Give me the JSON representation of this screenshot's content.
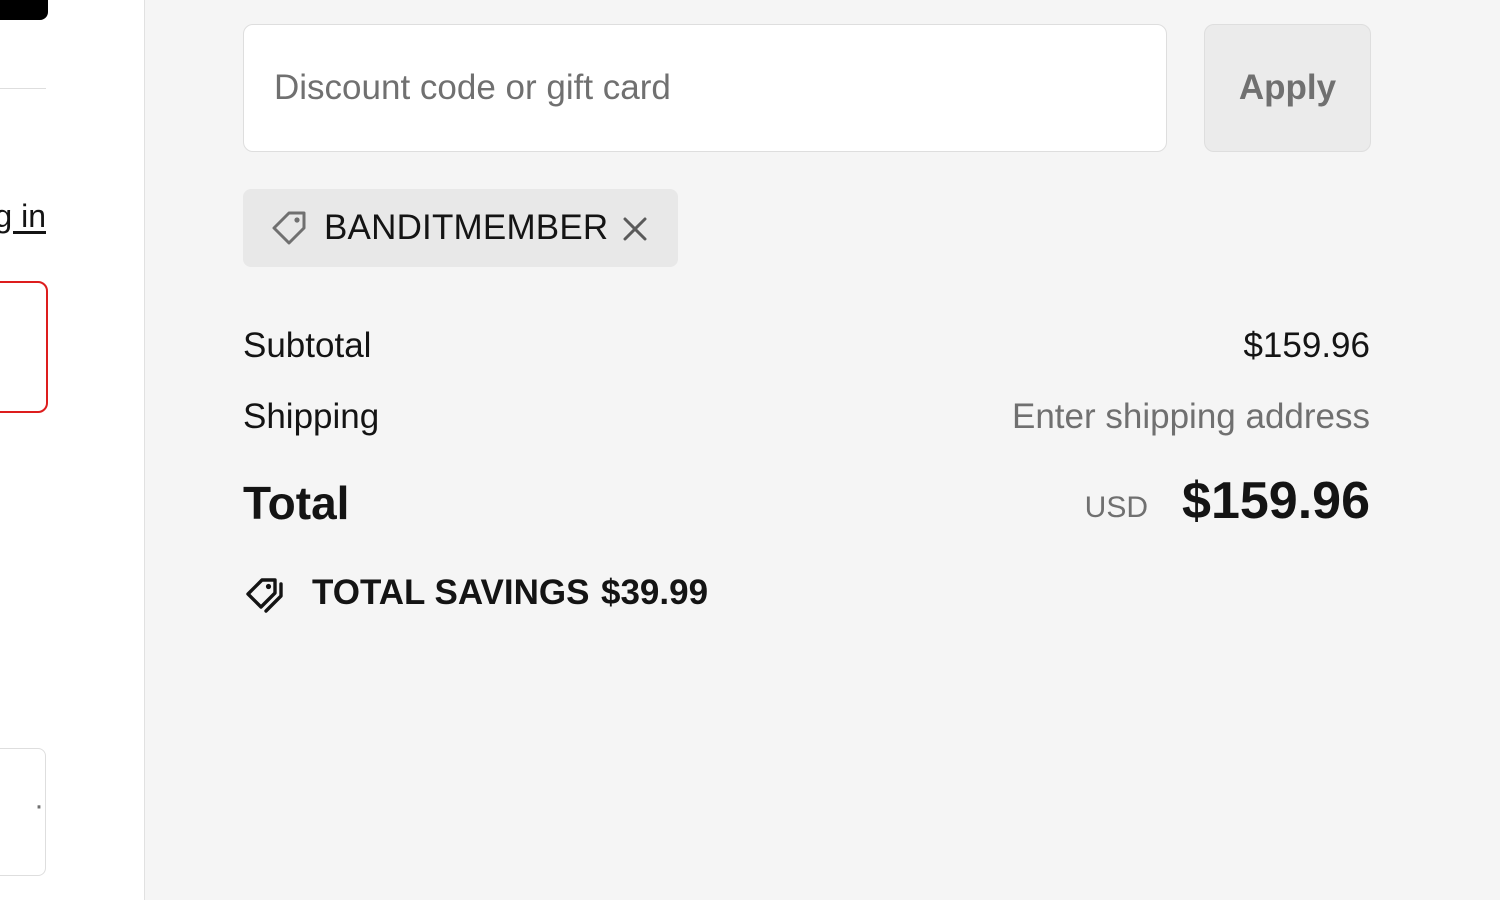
{
  "left_column": {
    "login_link": "g in",
    "bottom_field_glyph": "·"
  },
  "discount": {
    "placeholder": "Discount code or gift card",
    "value": "",
    "apply_label": "Apply"
  },
  "applied_code": {
    "code": "BANDITMEMBER",
    "icon": "tag-icon",
    "remove_icon": "close-icon"
  },
  "summary": {
    "subtotal_label": "Subtotal",
    "subtotal_value": "$159.96",
    "shipping_label": "Shipping",
    "shipping_value": "Enter shipping address",
    "total_label": "Total",
    "total_currency": "USD",
    "total_value": "$159.96",
    "savings_icon": "tags-icon",
    "savings_label": "TOTAL SAVINGS",
    "savings_value": "$39.99"
  },
  "colors": {
    "sidebar_background": "#f5f5f5",
    "text_primary": "#141414",
    "text_secondary": "#707070",
    "error_border": "#dd1d1d",
    "field_border": "#dedede",
    "chip_background": "#e8e8e8"
  }
}
